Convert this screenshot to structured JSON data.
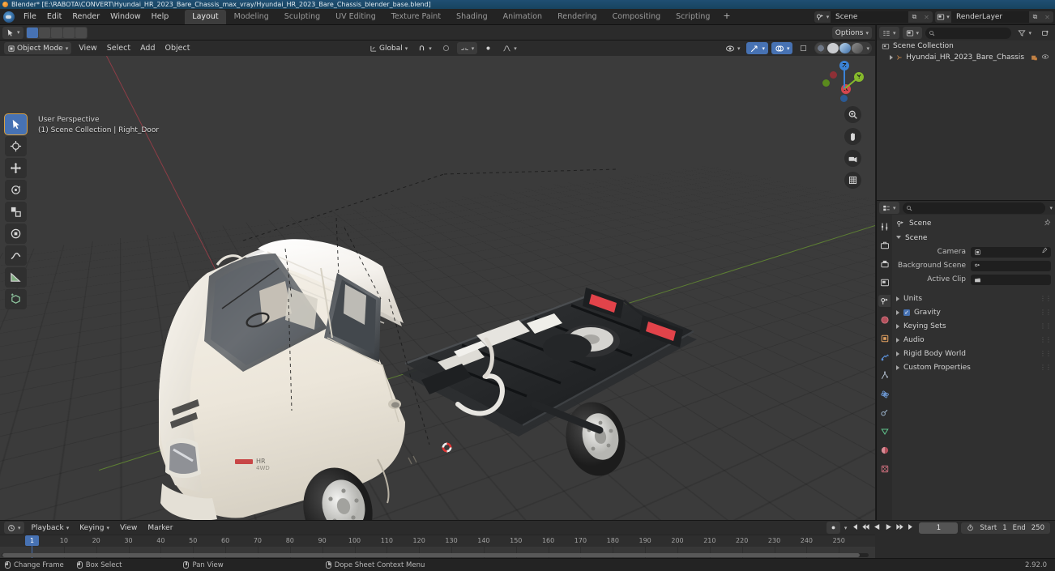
{
  "window": {
    "title": "Blender* [E:\\RABOTA\\CONVERT\\Hyundai_HR_2023_Bare_Chassis_max_vray/Hyundai_HR_2023_Bare_Chassis_blender_base.blend]"
  },
  "topbar": {
    "menus": [
      "File",
      "Edit",
      "Render",
      "Window",
      "Help"
    ],
    "workspaces": [
      {
        "label": "Layout",
        "active": true
      },
      {
        "label": "Modeling",
        "active": false
      },
      {
        "label": "Sculpting",
        "active": false
      },
      {
        "label": "UV Editing",
        "active": false
      },
      {
        "label": "Texture Paint",
        "active": false
      },
      {
        "label": "Shading",
        "active": false
      },
      {
        "label": "Animation",
        "active": false
      },
      {
        "label": "Rendering",
        "active": false
      },
      {
        "label": "Compositing",
        "active": false
      },
      {
        "label": "Scripting",
        "active": false
      }
    ],
    "add_workspace": "+",
    "scene_name": "Scene",
    "viewlayer_name": "RenderLayer"
  },
  "viewport_header": {
    "mode": "Object Mode",
    "menus": [
      "View",
      "Select",
      "Add",
      "Object"
    ],
    "transform_orientation": "Global",
    "options_label": "Options"
  },
  "viewport": {
    "overlay_line1": "User Perspective",
    "overlay_line2": "(1) Scene Collection | Right_Door",
    "gizmo_axes": [
      "X",
      "Y",
      "Z"
    ],
    "tools": [
      "select-box-tool",
      "cursor-tool",
      "move-tool",
      "rotate-tool",
      "scale-tool",
      "transform-tool",
      "annotate-tool",
      "measure-tool",
      "add-cube-tool"
    ],
    "nav_buttons": [
      "zoom-icon",
      "pan-icon",
      "camera-icon",
      "ortho-icon"
    ],
    "colors": {
      "background": "#3b3b3b",
      "x_axis": "#8d3d46",
      "y_axis": "#5d7f33",
      "body_paint": "#f1ece2",
      "chassis": "#232527",
      "taillight": "#e2434a"
    }
  },
  "outliner": {
    "search_placeholder": "",
    "scene_collection": "Scene Collection",
    "object_name": "Hyundai_HR_2023_Bare_Chassis"
  },
  "properties": {
    "breadcrumb": "Scene",
    "panel_title": "Scene",
    "fields": [
      {
        "label": "Camera",
        "value": ""
      },
      {
        "label": "Background Scene",
        "value": ""
      },
      {
        "label": "Active Clip",
        "value": ""
      }
    ],
    "sections": [
      {
        "label": "Units",
        "checkbox": false
      },
      {
        "label": "Gravity",
        "checkbox": true
      },
      {
        "label": "Keying Sets",
        "checkbox": false
      },
      {
        "label": "Audio",
        "checkbox": false
      },
      {
        "label": "Rigid Body World",
        "checkbox": false
      },
      {
        "label": "Custom Properties",
        "checkbox": false
      }
    ],
    "tabs": [
      "tool-tab",
      "render-tab",
      "output-tab",
      "view-layer-tab",
      "scene-tab",
      "world-tab",
      "object-tab",
      "modifier-tab",
      "particles-tab",
      "physics-tab",
      "constraints-tab",
      "data-tab",
      "material-tab",
      "texture-tab"
    ]
  },
  "timeline": {
    "menus": [
      "Playback",
      "Keying",
      "View",
      "Marker"
    ],
    "current_frame": "1",
    "start_label": "Start",
    "start_value": "1",
    "end_label": "End",
    "end_value": "250",
    "ticks": [
      10,
      20,
      30,
      40,
      50,
      60,
      70,
      80,
      90,
      100,
      110,
      120,
      130,
      140,
      150,
      160,
      170,
      180,
      190,
      200,
      210,
      220,
      230,
      240,
      250
    ],
    "playhead_label": "1"
  },
  "statusbar": {
    "items": [
      {
        "mouse": "left",
        "label": "Change Frame"
      },
      {
        "mouse": "left",
        "label": "Box Select"
      },
      {
        "mouse": "middle",
        "label": "Pan View"
      },
      {
        "mouse": "right",
        "label": "Dope Sheet Context Menu"
      }
    ],
    "version": "2.92.0"
  }
}
